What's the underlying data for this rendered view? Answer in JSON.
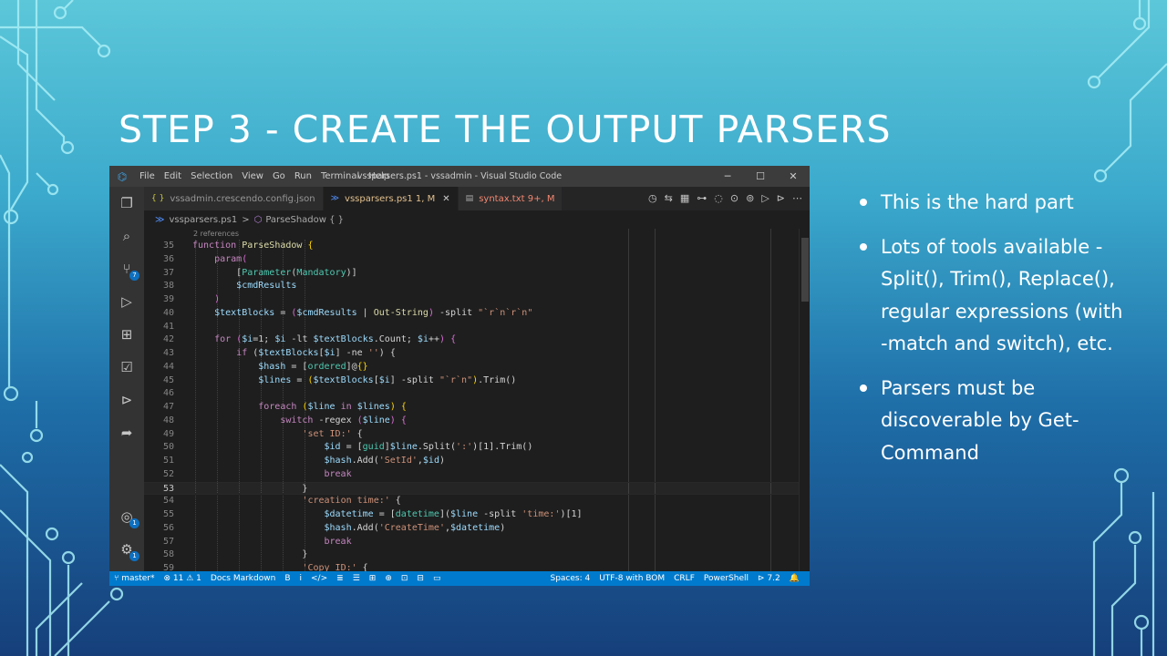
{
  "slide": {
    "title": "STEP 3 - CREATE THE OUTPUT PARSERS",
    "bullets": [
      "This is the hard part",
      "Lots of tools available - Split(), Trim(), Replace(), regular expressions (with -match and switch), etc.",
      "Parsers must be discoverable by Get-Command"
    ]
  },
  "vscode": {
    "menu": [
      "File",
      "Edit",
      "Selection",
      "View",
      "Go",
      "Run",
      "Terminal",
      "Help"
    ],
    "window_title": "vssparsers.ps1 - vssadmin - Visual Studio Code",
    "window_buttons": {
      "minimize": "─",
      "maximize": "☐",
      "close": "✕"
    },
    "tabs": [
      {
        "icon": "{ }",
        "label": "vssadmin.crescendo.config.json"
      },
      {
        "icon": "≫",
        "label": "vssparsers.ps1 1, M",
        "close": "✕"
      },
      {
        "icon": "▤",
        "label": "syntax.txt 9+, M"
      }
    ],
    "tab_actions": [
      "◷",
      "⇆",
      "▦",
      "⊶",
      "◌",
      "⊙",
      "⊚",
      "▷",
      "⊳",
      "⋯"
    ],
    "breadcrumb": {
      "file": "vssparsers.ps1",
      "separator": ">",
      "symbol": "ParseShadow { }"
    },
    "codelens": "2 references",
    "activity_badges": {
      "source_control": "7",
      "accounts": "1",
      "settings": "1"
    },
    "code_lines": [
      {
        "n": "35",
        "html": "<span class='kw'>function</span> <span class='fn'>ParseShadow</span> <span class='pn'>{</span>"
      },
      {
        "n": "36",
        "html": "    <span class='kw'>param</span><span class='cb'>(</span>"
      },
      {
        "n": "37",
        "html": "        <span class='op'>[</span><span class='ty'>Parameter</span><span class='op'>(</span><span class='ty'>Mandatory</span><span class='op'>)]</span>"
      },
      {
        "n": "38",
        "html": "        <span class='vr'>$cmdResults</span>"
      },
      {
        "n": "39",
        "html": "    <span class='cb'>)</span>"
      },
      {
        "n": "40",
        "html": "    <span class='vr'>$textBlocks</span> = <span class='cb'>(</span><span class='vr'>$cmdResults</span> | <span class='fn'>Out-String</span><span class='cb'>)</span> -split <span class='st'>\"`r`n`r`n\"</span>"
      },
      {
        "n": "41",
        "html": ""
      },
      {
        "n": "42",
        "html": "    <span class='kw'>for</span> <span class='cb'>(</span><span class='vr'>$i</span>=1; <span class='vr'>$i</span> -lt <span class='vr'>$textBlocks</span>.Count; <span class='vr'>$i</span>++<span class='cb'>)</span> <span class='cb'>{</span>"
      },
      {
        "n": "43",
        "html": "        <span class='kw'>if</span> <span class='op'>(</span><span class='vr'>$textBlocks</span>[<span class='vr'>$i</span>] -ne <span class='st'>''</span><span class='op'>)</span> <span class='op'>{</span>"
      },
      {
        "n": "44",
        "html": "            <span class='vr'>$hash</span> = [<span class='ty'>ordered</span>]@<span class='pn'>{}</span>"
      },
      {
        "n": "45",
        "html": "            <span class='vr'>$lines</span> = <span class='pn'>(</span><span class='vr'>$textBlocks</span>[<span class='vr'>$i</span>] -split <span class='st'>\"`r`n\"</span><span class='pn'>)</span>.Trim()"
      },
      {
        "n": "46",
        "html": ""
      },
      {
        "n": "47",
        "html": "            <span class='kw'>foreach</span> <span class='pn'>(</span><span class='vr'>$line</span> <span class='kw'>in</span> <span class='vr'>$lines</span><span class='pn'>)</span> <span class='pn'>{</span>"
      },
      {
        "n": "48",
        "html": "                <span class='kw'>switch</span> -regex <span class='cb'>(</span><span class='vr'>$line</span><span class='cb'>)</span> <span class='cb'>{</span>"
      },
      {
        "n": "49",
        "html": "                    <span class='st'>'set ID:'</span> <span class='op'>{</span>"
      },
      {
        "n": "50",
        "html": "                        <span class='vr'>$id</span> = [<span class='ty'>guid</span>]<span class='vr'>$line</span>.Split(<span class='st'>':'</span>)[1].Trim()"
      },
      {
        "n": "51",
        "html": "                        <span class='vr'>$hash</span>.Add(<span class='st'>'SetId'</span>,<span class='vr'>$id</span>)"
      },
      {
        "n": "52",
        "html": "                        <span class='kw'>break</span>"
      },
      {
        "n": "53",
        "html": "                    <span class='op'>}</span>"
      },
      {
        "n": "54",
        "html": "                    <span class='st'>'creation time:'</span> <span class='op'>{</span>"
      },
      {
        "n": "55",
        "html": "                        <span class='vr'>$datetime</span> = [<span class='ty'>datetime</span>](<span class='vr'>$line</span> -split <span class='st'>'time:'</span>)[1]"
      },
      {
        "n": "56",
        "html": "                        <span class='vr'>$hash</span>.Add(<span class='st'>'CreateTime'</span>,<span class='vr'>$datetime</span>)"
      },
      {
        "n": "57",
        "html": "                        <span class='kw'>break</span>"
      },
      {
        "n": "58",
        "html": "                    <span class='op'>}</span>"
      },
      {
        "n": "59",
        "html": "                    <span class='st'>'Copy ID:'</span> <span class='op'>{</span>"
      }
    ],
    "status": {
      "branch": "master*",
      "problems": "⊗ 11 ⚠ 1",
      "docs": "Docs Markdown",
      "md_tools": [
        "B",
        "i",
        "</>",
        "≣",
        "☰",
        "⊞",
        "⊕",
        "⊡",
        "⊟",
        "▭"
      ],
      "spaces": "Spaces: 4",
      "encoding": "UTF-8 with BOM",
      "eol": "CRLF",
      "language": "PowerShell",
      "version": "7.2"
    }
  }
}
